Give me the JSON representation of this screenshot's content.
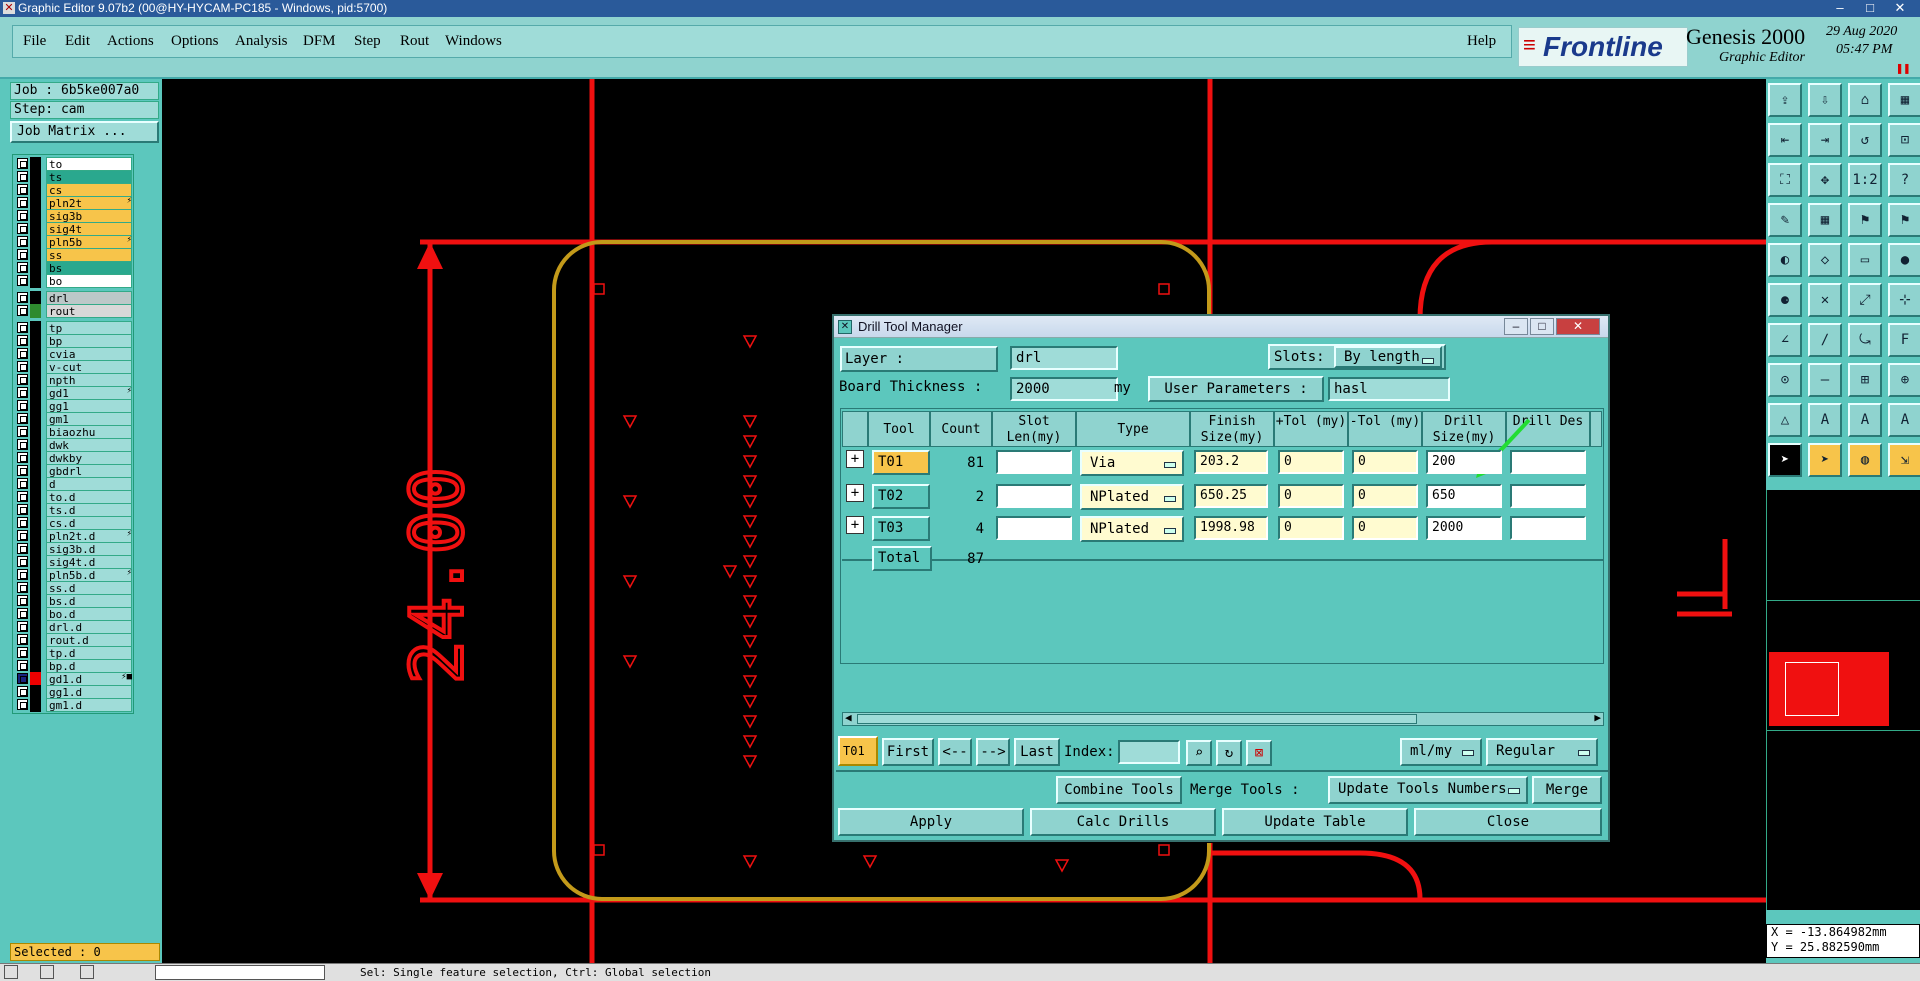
{
  "window": {
    "title": "Graphic Editor 9.07b2 (00@HY-HYCAM-PC185 - Windows, pid:5700)",
    "min": "–",
    "max": "□",
    "close": "✕"
  },
  "menu": {
    "items": [
      "File",
      "Edit",
      "Actions",
      "Options",
      "Analysis",
      "DFM",
      "Step",
      "Rout",
      "Windows"
    ],
    "help": "Help"
  },
  "brand": {
    "logo": "Frontline",
    "product": "Genesis 2000",
    "subtitle": "Graphic Editor",
    "date": "29 Aug 2020",
    "time": "05:47 PM"
  },
  "job": {
    "job": "Job : 6b5ke007a0",
    "step": "Step: cam",
    "matrix": "Job Matrix ..."
  },
  "layers": [
    {
      "name": "to",
      "color": "#ffffff",
      "mark": ""
    },
    {
      "name": "ts",
      "color": "#2aa88e",
      "mark": ""
    },
    {
      "name": "cs",
      "color": "#f7c44a",
      "mark": ""
    },
    {
      "name": "pln2t",
      "color": "#f7c44a",
      "mark": "⚡"
    },
    {
      "name": "sig3b",
      "color": "#f7c44a",
      "mark": ""
    },
    {
      "name": "sig4t",
      "color": "#f7c44a",
      "mark": ""
    },
    {
      "name": "pln5b",
      "color": "#f7c44a",
      "mark": "⚡"
    },
    {
      "name": "ss",
      "color": "#f7c44a",
      "mark": ""
    },
    {
      "name": "bs",
      "color": "#2aa88e",
      "mark": ""
    },
    {
      "name": "bo",
      "color": "#ffffff",
      "mark": ""
    },
    {
      "name": "drl",
      "color": "#bcc8c8",
      "mark": ""
    },
    {
      "name": "rout",
      "color": "#d8d8d8",
      "mark": ""
    },
    {
      "name": "tp",
      "color": "#9fdcd8",
      "mark": ""
    },
    {
      "name": "bp",
      "color": "#9fdcd8",
      "mark": ""
    },
    {
      "name": "cvia",
      "color": "#9fdcd8",
      "mark": ""
    },
    {
      "name": "v-cut",
      "color": "#9fdcd8",
      "mark": ""
    },
    {
      "name": "npth",
      "color": "#9fdcd8",
      "mark": ""
    },
    {
      "name": "gd1",
      "color": "#9fdcd8",
      "mark": "⚡"
    },
    {
      "name": "gg1",
      "color": "#9fdcd8",
      "mark": ""
    },
    {
      "name": "gm1",
      "color": "#9fdcd8",
      "mark": ""
    },
    {
      "name": "biaozhu",
      "color": "#9fdcd8",
      "mark": ""
    },
    {
      "name": "dwk",
      "color": "#9fdcd8",
      "mark": ""
    },
    {
      "name": "dwkby",
      "color": "#9fdcd8",
      "mark": ""
    },
    {
      "name": "gbdrl",
      "color": "#9fdcd8",
      "mark": ""
    },
    {
      "name": "d",
      "color": "#9fdcd8",
      "mark": ""
    },
    {
      "name": "to.d",
      "color": "#9fdcd8",
      "mark": ""
    },
    {
      "name": "ts.d",
      "color": "#9fdcd8",
      "mark": ""
    },
    {
      "name": "cs.d",
      "color": "#9fdcd8",
      "mark": ""
    },
    {
      "name": "pln2t.d",
      "color": "#9fdcd8",
      "mark": "⚡"
    },
    {
      "name": "sig3b.d",
      "color": "#9fdcd8",
      "mark": ""
    },
    {
      "name": "sig4t.d",
      "color": "#9fdcd8",
      "mark": ""
    },
    {
      "name": "pln5b.d",
      "color": "#9fdcd8",
      "mark": "⚡"
    },
    {
      "name": "ss.d",
      "color": "#9fdcd8",
      "mark": ""
    },
    {
      "name": "bs.d",
      "color": "#9fdcd8",
      "mark": ""
    },
    {
      "name": "bo.d",
      "color": "#9fdcd8",
      "mark": ""
    },
    {
      "name": "drl.d",
      "color": "#9fdcd8",
      "mark": ""
    },
    {
      "name": "rout.d",
      "color": "#9fdcd8",
      "mark": ""
    },
    {
      "name": "tp.d",
      "color": "#9fdcd8",
      "mark": ""
    },
    {
      "name": "bp.d",
      "color": "#9fdcd8",
      "mark": ""
    },
    {
      "name": "gd1.d",
      "color": "#9fdcd8",
      "mark": "⚡■"
    },
    {
      "name": "gg1.d",
      "color": "#9fdcd8",
      "mark": ""
    },
    {
      "name": "gm1.d",
      "color": "#9fdcd8",
      "mark": ""
    }
  ],
  "selected": "Selected : 0",
  "canvas": {
    "dimension": "24.00"
  },
  "coords": {
    "x": "X = -13.864982mm",
    "y": "Y = 25.882590mm"
  },
  "status": {
    "text": "Sel: Single feature selection, Ctrl: Global selection"
  },
  "dialog": {
    "title": "Drill Tool Manager",
    "layer_label": "Layer        :",
    "layer_value": "drl",
    "slots_label": "Slots:",
    "slots_value": "By length",
    "thickness_label": "Board Thickness :",
    "thickness_value": "2000",
    "thickness_unit": "my",
    "userparams_label": "User Parameters :",
    "userparams_value": "hasl",
    "headers": [
      "Tool",
      "Count",
      "Slot Len(my)",
      "Type",
      "Finish Size(my)",
      "+Tol (my)",
      "-Tol (my)",
      "Drill Size(my)",
      "Drill Des"
    ],
    "rows": [
      {
        "tool": "T01",
        "count": "81",
        "type": "Via",
        "finish": "203.2",
        "ptol": "0",
        "mtol": "0",
        "drill": "200"
      },
      {
        "tool": "T02",
        "count": "2",
        "type": "NPlated",
        "finish": "650.25",
        "ptol": "0",
        "mtol": "0",
        "drill": "650"
      },
      {
        "tool": "T03",
        "count": "4",
        "type": "NPlated",
        "finish": "1998.98",
        "ptol": "0",
        "mtol": "0",
        "drill": "2000"
      }
    ],
    "total_label": "Total",
    "total_count": "87",
    "nav": {
      "current": "T01",
      "first": "First",
      "prev": "<--",
      "next": "-->",
      "last": "Last",
      "index": "Index:",
      "units": "ml/my",
      "mode": "Regular"
    },
    "combine": "Combine Tools",
    "merge_label": "Merge Tools :",
    "merge_opt": "Update Tools Numbers",
    "merge": "Merge",
    "apply": "Apply",
    "calc": "Calc Drills",
    "update": "Update Table",
    "close": "Close"
  }
}
